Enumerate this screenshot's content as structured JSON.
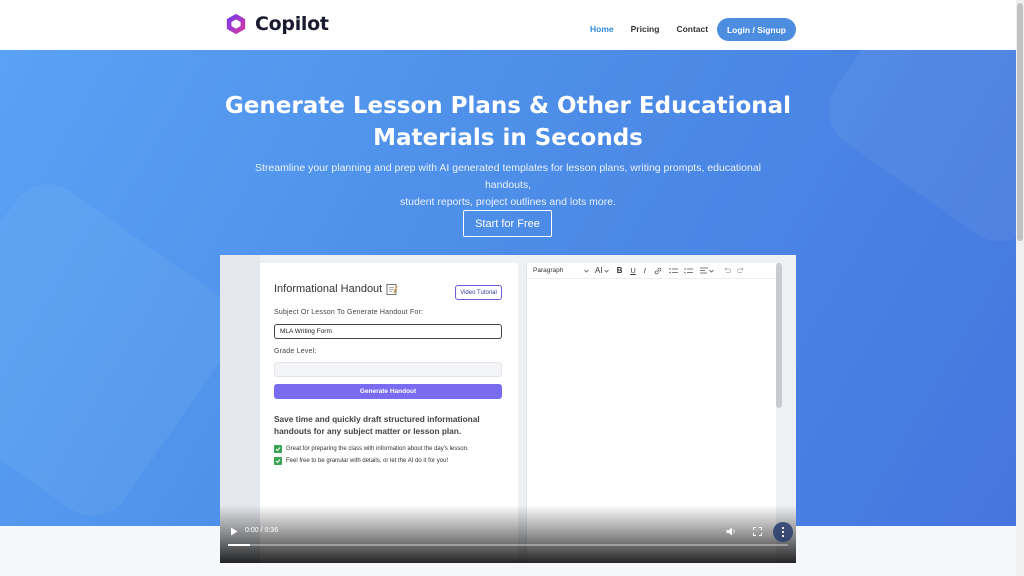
{
  "brand": {
    "name": "Copilot",
    "accent": "#4c8de0"
  },
  "nav": {
    "links": [
      {
        "label": "Home",
        "active": true
      },
      {
        "label": "Pricing",
        "active": false
      },
      {
        "label": "Contact",
        "active": false
      }
    ],
    "login_label": "Login / Signup"
  },
  "hero": {
    "title_line1": "Generate Lesson Plans & Other Educational",
    "title_line2": "Materials in Seconds",
    "subtitle_line1": "Streamline your planning and prep with AI generated templates for lesson plans, writing prompts, educational handouts,",
    "subtitle_line2": "student reports, project outlines and lots more.",
    "cta_label": "Start for Free"
  },
  "video": {
    "form": {
      "title": "Informational Handout",
      "tutorial_label": "Video Tutorial",
      "subject_label": "Subject Or Lesson To Generate Handout For:",
      "subject_value": "MLA Writing Form",
      "grade_label": "Grade Level:",
      "grade_value": "",
      "generate_label": "Generate Handout",
      "description": "Save time and quickly draft structured informational handouts for any subject matter or lesson plan.",
      "checks": [
        "Great for preparing the class with information about the day's lesson.",
        "Feel free to be granular with details, or let the AI do it for you!"
      ]
    },
    "editor": {
      "paragraph_label": "Paragraph",
      "font_size_label": "AI",
      "bold_label": "B",
      "underline_label": "U",
      "italic_label": "I"
    },
    "player": {
      "time": "0:00 / 0:36",
      "progress": 0.04
    }
  },
  "icons": [
    "copilot-logo-icon",
    "notepad-icon",
    "chevron-down-icon",
    "link-icon",
    "bullet-list-icon",
    "numbered-list-icon",
    "align-icon",
    "undo-icon",
    "redo-icon",
    "play-icon",
    "volume-icon",
    "fullscreen-icon",
    "more-icon",
    "check-icon"
  ]
}
